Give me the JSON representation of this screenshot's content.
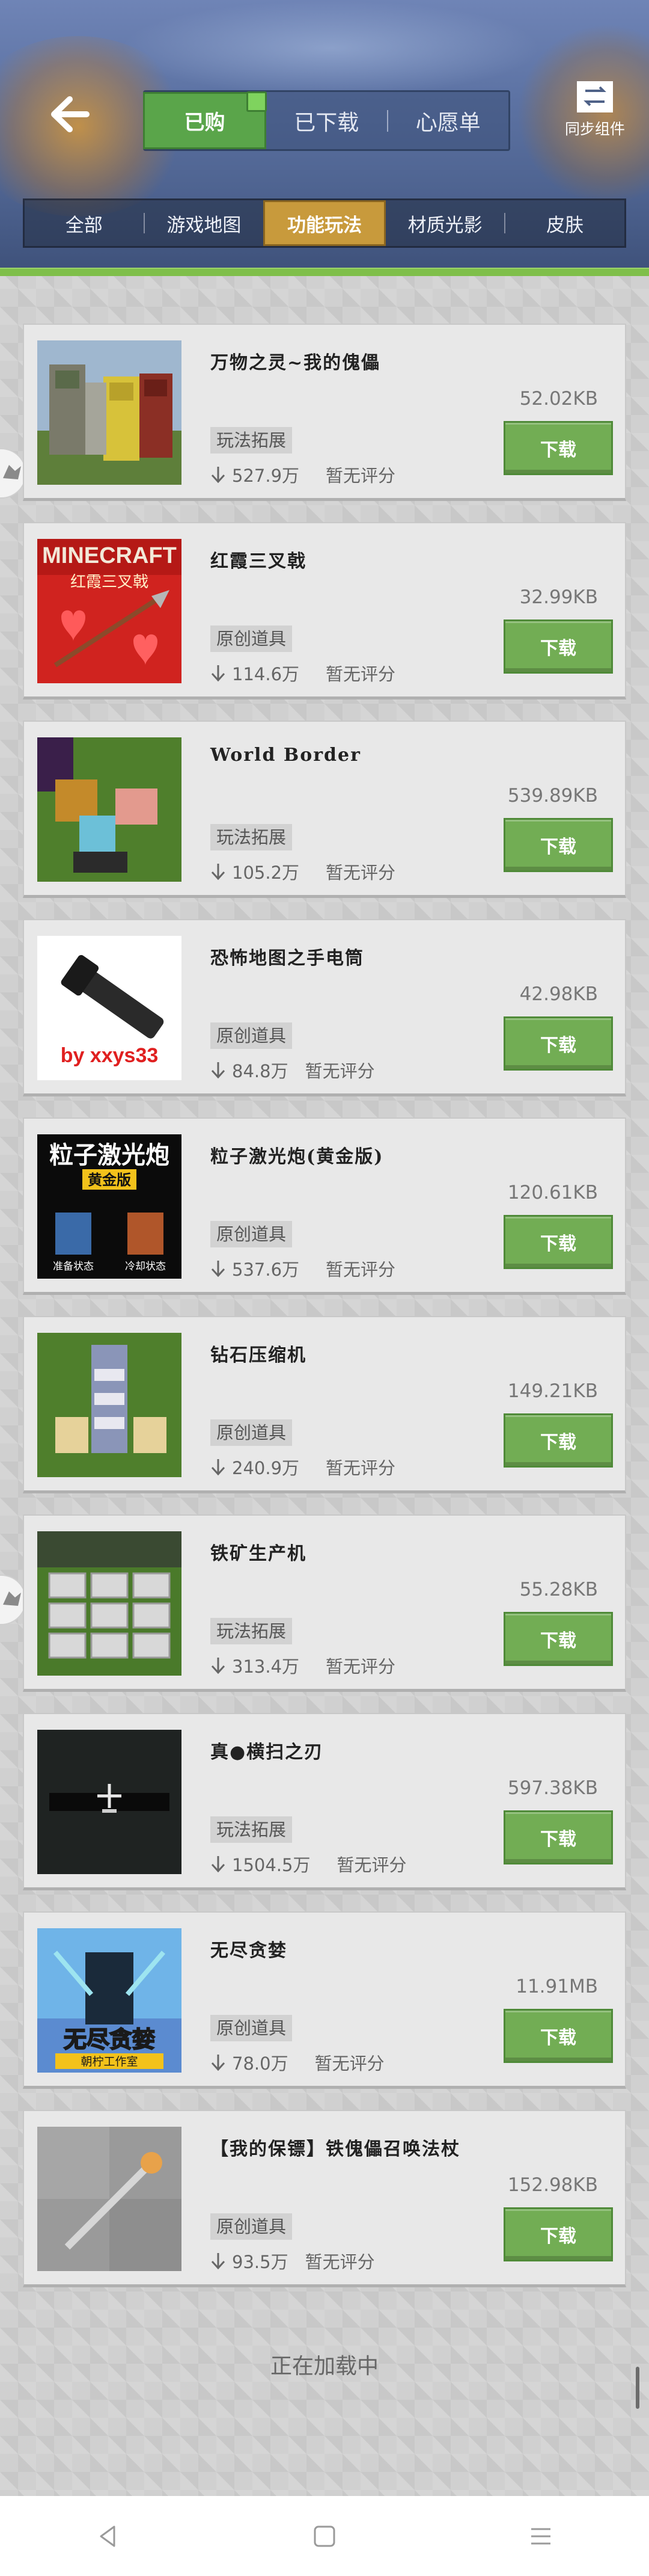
{
  "header": {
    "tabs": [
      {
        "label": "已购",
        "active": true
      },
      {
        "label": "已下载",
        "active": false
      },
      {
        "label": "心愿单",
        "active": false
      }
    ],
    "sync_label": "同步组件",
    "categories": [
      {
        "label": "全部",
        "active": false
      },
      {
        "label": "游戏地图",
        "active": false
      },
      {
        "label": "功能玩法",
        "active": true
      },
      {
        "label": "材质光影",
        "active": false
      },
      {
        "label": "皮肤",
        "active": false
      }
    ]
  },
  "colors": {
    "accent_green": "#72ad54",
    "active_category": "#c89a3c",
    "active_tab": "#5aa54a"
  },
  "items": [
    {
      "title": "万物之灵~我的傀儡",
      "size": "52.02KB",
      "tag": "玩法拓展",
      "downloads": "527.9万",
      "rating": "暂无评分",
      "button": "下载"
    },
    {
      "title": "红霞三叉戟",
      "size": "32.99KB",
      "tag": "原创道具",
      "downloads": "114.6万",
      "rating": "暂无评分",
      "button": "下载",
      "thumb_text": "MINECRAFT",
      "thumb_sub": "红霞三叉戟"
    },
    {
      "title": "World Border",
      "size": "539.89KB",
      "tag": "玩法拓展",
      "downloads": "105.2万",
      "rating": "暂无评分",
      "button": "下载"
    },
    {
      "title": "恐怖地图之手电筒",
      "size": "42.98KB",
      "tag": "原创道具",
      "downloads": "84.8万",
      "rating": "暂无评分",
      "button": "下载",
      "thumb_text": "by  xxys33"
    },
    {
      "title": "粒子激光炮(黄金版)",
      "size": "120.61KB",
      "tag": "原创道具",
      "downloads": "537.6万",
      "rating": "暂无评分",
      "button": "下载",
      "thumb_text": "粒子激光炮",
      "thumb_sub": "黄金版",
      "thumb_l": "准备状态",
      "thumb_r": "冷却状态"
    },
    {
      "title": "钻石压缩机",
      "size": "149.21KB",
      "tag": "原创道具",
      "downloads": "240.9万",
      "rating": "暂无评分",
      "button": "下载"
    },
    {
      "title": "铁矿生产机",
      "size": "55.28KB",
      "tag": "玩法拓展",
      "downloads": "313.4万",
      "rating": "暂无评分",
      "button": "下载"
    },
    {
      "title": "真●横扫之刃",
      "size": "597.38KB",
      "tag": "玩法拓展",
      "downloads": "1504.5万",
      "rating": "暂无评分",
      "button": "下载"
    },
    {
      "title": "无尽贪婪",
      "size": "11.91MB",
      "tag": "原创道具",
      "downloads": "78.0万",
      "rating": "暂无评分",
      "button": "下载",
      "thumb_text": "无尽贪婪",
      "thumb_sub": "朝柠工作室"
    },
    {
      "title": "【我的保镖】铁傀儡召唤法杖",
      "size": "152.98KB",
      "tag": "原创道具",
      "downloads": "93.5万",
      "rating": "暂无评分",
      "button": "下载"
    }
  ],
  "loading_text": "正在加载中"
}
